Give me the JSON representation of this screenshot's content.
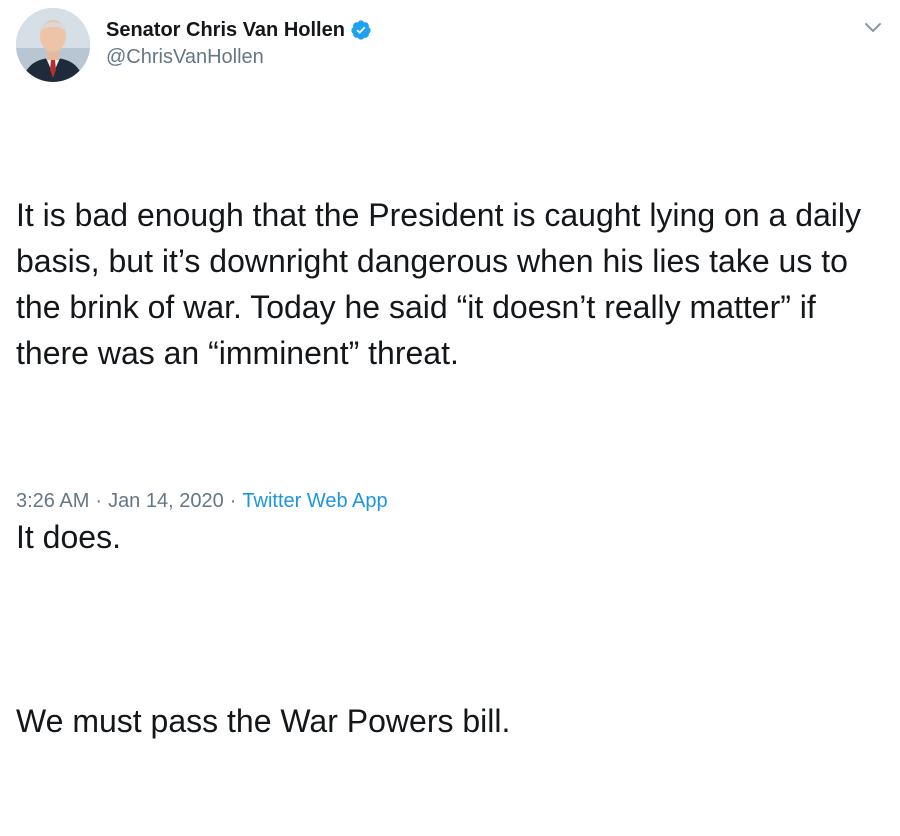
{
  "author": {
    "display_name": "Senator Chris Van Hollen",
    "handle": "@ChrisVanHollen",
    "verified": true
  },
  "tweet": {
    "paragraph_1": "It is bad enough that the President is caught lying on a daily basis, but it’s downright dangerous when his lies take us to the brink of war. Today he said “it doesn’t really matter” if there was an “imminent” threat.",
    "paragraph_2": "It does.",
    "paragraph_3": "We must pass the War Powers bill."
  },
  "meta": {
    "time": "3:26 AM",
    "separator": "·",
    "date": "Jan 14, 2020",
    "source": "Twitter Web App"
  },
  "icons": {
    "verified": "verified-badge-icon",
    "menu": "chevron-down-icon"
  },
  "colors": {
    "text": "#14171a",
    "secondary": "#657786",
    "link": "#1b95e0",
    "verified": "#1da1f2"
  }
}
